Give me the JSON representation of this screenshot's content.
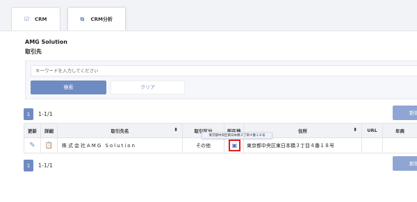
{
  "tabs": [
    {
      "label": "CRM",
      "icon": "check-square-icon"
    },
    {
      "label": "CRM分析",
      "icon": "chart-icon"
    }
  ],
  "header": {
    "org_name": "AMG Solution",
    "page_title": "取引先"
  },
  "search": {
    "placeholder": "キーワードを入力してください",
    "search_label": "検索",
    "clear_label": "クリア"
  },
  "pagination": {
    "current_page": "1",
    "range": "1-1/1"
  },
  "new_button": {
    "label": "新規"
  },
  "table": {
    "columns": [
      "更新",
      "詳細",
      "取引先名",
      "取引区分",
      "所在地",
      "住所",
      "URL",
      "年商"
    ],
    "rows": [
      {
        "company": "株式会社AMG Solution",
        "category": "その他",
        "address": "東京都中央区東日本橋３丁目４番１８号"
      }
    ]
  },
  "tooltip": {
    "text": "東京都中央区東日本橋３丁目４番１８号"
  },
  "colors": {
    "accent": "#6f8bc3",
    "highlight_border": "#e21b1b"
  }
}
